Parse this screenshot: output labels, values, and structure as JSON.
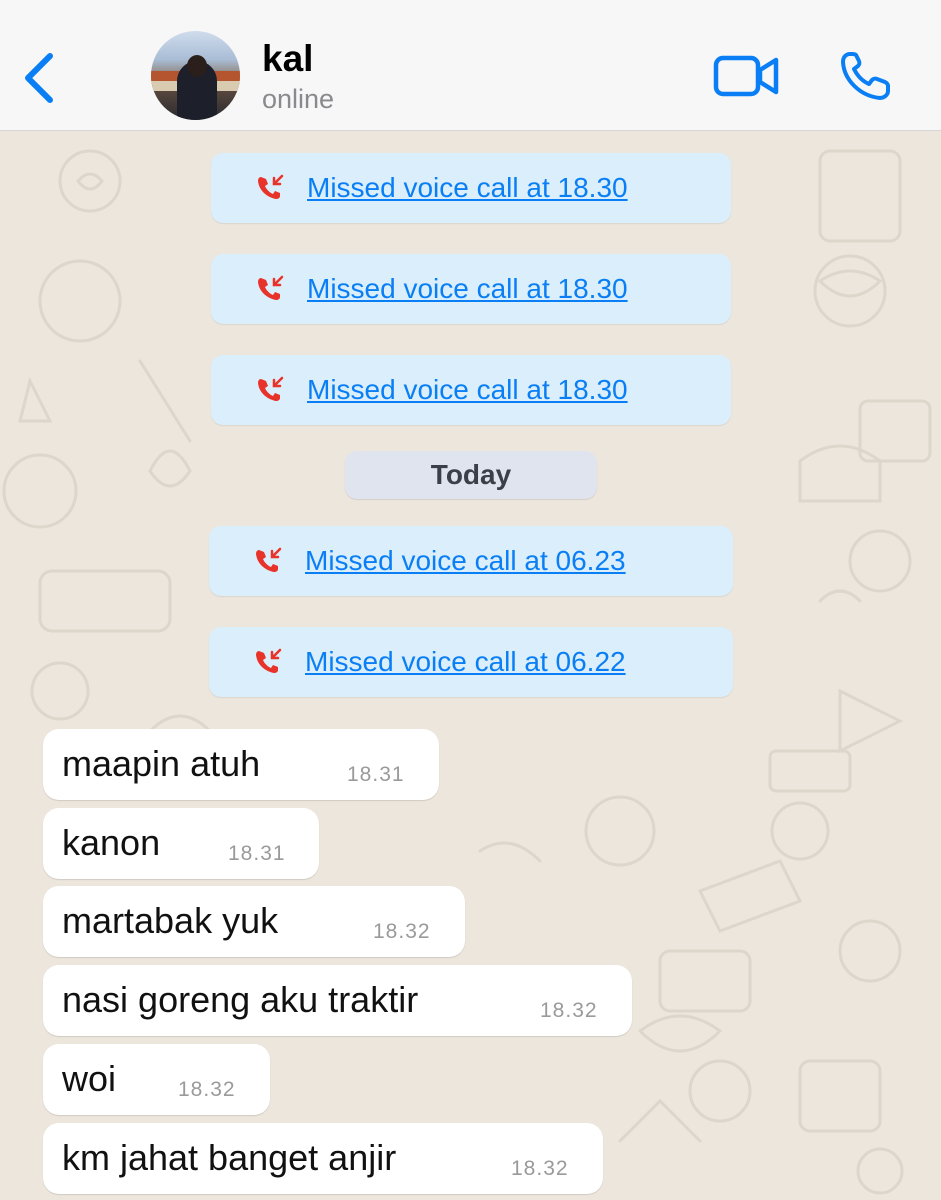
{
  "header": {
    "back_icon": "chevron-left-icon",
    "contact_name": "kal",
    "status": "online",
    "video_icon": "video-camera-icon",
    "phone_icon": "phone-icon",
    "accent_color": "#0a7ff5"
  },
  "chat": {
    "missed_calls": [
      {
        "label": "Missed voice call at 18.30",
        "icon": "missed-call-icon"
      },
      {
        "label": "Missed voice call at 18.30",
        "icon": "missed-call-icon"
      },
      {
        "label": "Missed voice call at 18.30",
        "icon": "missed-call-icon"
      },
      {
        "label": "Missed voice call at 06.23",
        "icon": "missed-call-icon"
      },
      {
        "label": "Missed voice call at 06.22",
        "icon": "missed-call-icon"
      }
    ],
    "date_separator": "Today",
    "messages": [
      {
        "text": "maapin atuh",
        "time": "18.31"
      },
      {
        "text": "kanon",
        "time": "18.31"
      },
      {
        "text": "martabak yuk",
        "time": "18.32"
      },
      {
        "text": "nasi goreng aku traktir",
        "time": "18.32"
      },
      {
        "text": "woi",
        "time": "18.32"
      },
      {
        "text": "km jahat banget anjir",
        "time": "18.32"
      }
    ],
    "colors": {
      "call_bubble": "#daeefb",
      "missed_call_red": "#e8332a",
      "incoming_bubble": "#ffffff",
      "wallpaper": "#ece6dd"
    }
  }
}
